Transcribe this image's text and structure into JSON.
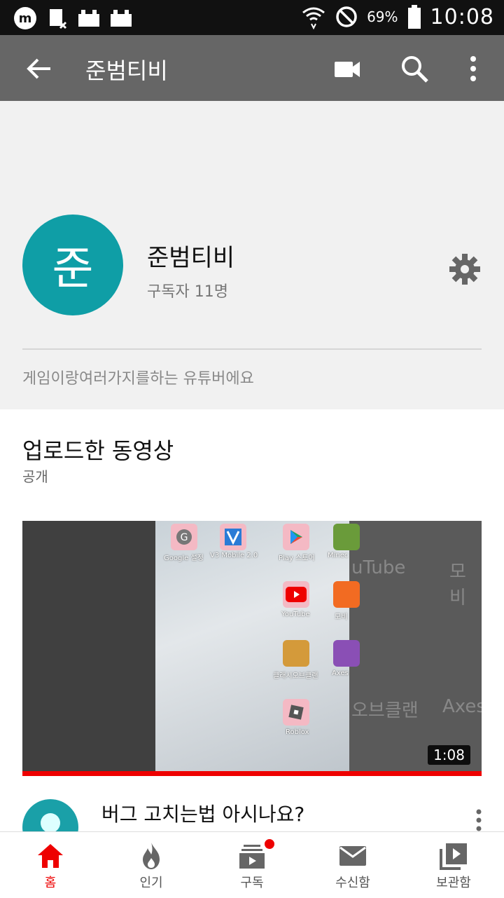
{
  "status_bar": {
    "battery": "69%",
    "time": "10:08"
  },
  "app_bar": {
    "title": "준범티비"
  },
  "channel": {
    "avatar_letter": "준",
    "name": "준범티비",
    "subscribers": "구독자 11명",
    "description": "게임이랑여러가지를하는 유튜버에요"
  },
  "section": {
    "title": "업로드한 동영상",
    "subtitle": "공개"
  },
  "video": {
    "duration": "1:08",
    "title": "버그 고치는법 아시나요?",
    "thumbnail_apps": [
      "Google 설정",
      "V3 Mobile 2.0",
      "Play 스토어",
      "Minec",
      "YouTube",
      "모비",
      "클래시오브클랜",
      "Axes",
      "Roblox"
    ],
    "thumbnail_bigtext": [
      "uTube",
      "모비",
      "오브클랜",
      "Axes"
    ]
  },
  "bottom_nav": [
    {
      "label": "홈"
    },
    {
      "label": "인기"
    },
    {
      "label": "구독"
    },
    {
      "label": "수신함"
    },
    {
      "label": "보관함"
    }
  ],
  "colors": {
    "accent": "#e00000",
    "avatar": "#0f9ea6",
    "app_bar": "#666666"
  }
}
